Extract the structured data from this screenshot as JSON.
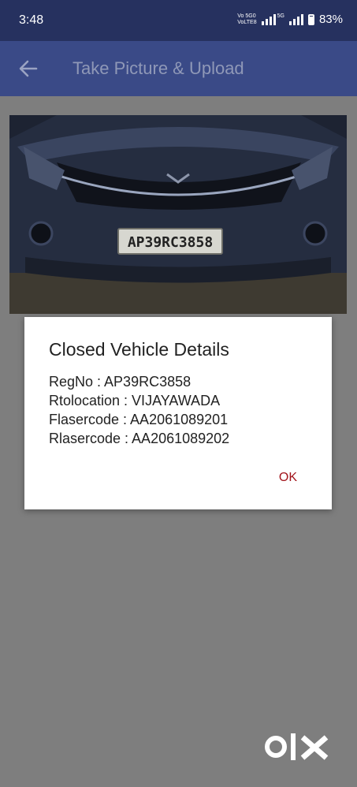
{
  "status_bar": {
    "time": "3:48",
    "net_line1": "Vo 5G0",
    "net_line2": "VoLTE8",
    "sig_tag": "5G",
    "battery_percent": "83%"
  },
  "app_bar": {
    "title": "Take Picture & Upload",
    "back_icon": "arrow-left-icon"
  },
  "photo": {
    "plate_text": "AP39RC3858"
  },
  "dialog": {
    "title": "Closed Vehicle Details",
    "lines": [
      "RegNo : AP39RC3858",
      "Rtolocation : VIJAYAWADA",
      "Flasercode : AA2061089201",
      "Rlasercode : AA2061089202"
    ],
    "ok_label": "OK"
  },
  "watermark": {
    "brand": "OLX"
  },
  "colors": {
    "status_bar": "#26315f",
    "app_bar": "#3a4a87",
    "scrim": "#7e7e7e",
    "ok_accent": "#a2141b"
  }
}
